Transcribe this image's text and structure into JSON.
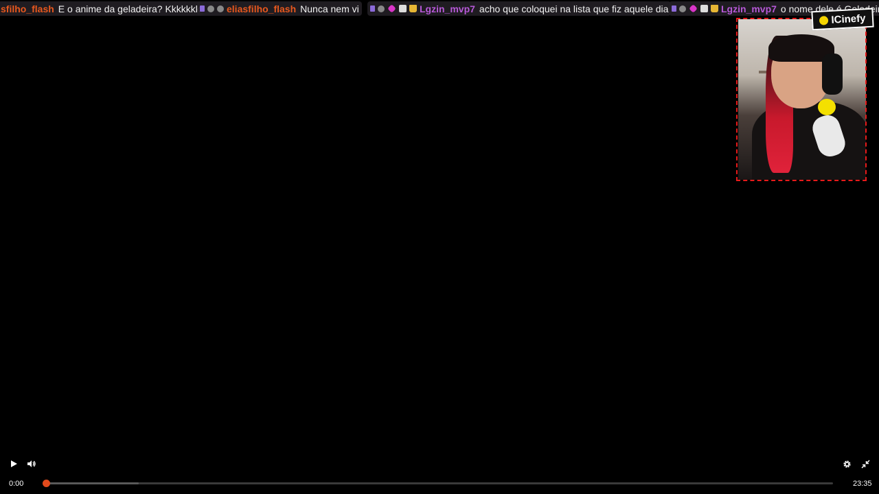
{
  "chat": [
    {
      "badges": [],
      "user": "sfilho_flash",
      "user_color": "#e8581e",
      "text": "E o anime da geladeira? Kkkkkkk"
    },
    {
      "badges": [
        "sub",
        "gray",
        "gray"
      ],
      "user": "eliasfilho_flash",
      "user_color": "#e8581e",
      "text": "Nunca nem vi"
    },
    {
      "badges": [
        "sub",
        "gray",
        "gem",
        "white",
        "crown"
      ],
      "user": "Lgzin_mvp7",
      "user_color": "#b759d8",
      "text": "acho que coloquei na lista que fiz aquele dia"
    },
    {
      "badges": [
        "sub",
        "gray",
        "gem",
        "white",
        "crown"
      ],
      "user": "Lgzin_mvp7",
      "user_color": "#b759d8",
      "text": "o nome dele é Geladeira"
    }
  ],
  "logo": {
    "text": "ICinefy"
  },
  "player": {
    "current_time": "0:00",
    "duration": "23:35",
    "progress_fraction": 0.0,
    "buffered_fraction": 0.118,
    "accent_color": "#e24a1c"
  },
  "icons": {
    "play": "play-icon",
    "volume": "volume-icon",
    "settings": "gear-icon",
    "exit_fullscreen": "exit-fullscreen-icon"
  }
}
